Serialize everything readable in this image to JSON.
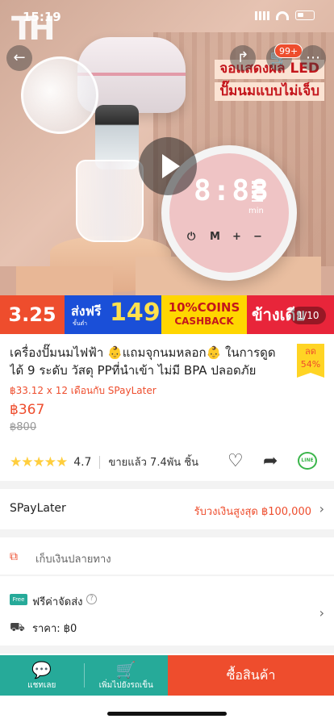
{
  "status_bar": {
    "time": "15:19"
  },
  "hero": {
    "promo_line1": "จอแสดงผล LED",
    "promo_line2": "ปั๊มนมแบบไม่เจ็บ",
    "screen_digits": "8:88",
    "screen_unit": "min",
    "screen_controls": [
      "⏻",
      "M",
      "+",
      "−"
    ],
    "cart_badge": "99+",
    "image_counter": "1/10"
  },
  "banner": {
    "date": "3.25",
    "free_ship_label": "ส่งฟรี",
    "free_ship_min": "ขั้นต่ำ",
    "free_ship_amount": "149",
    "coins_line1": "10%COINS",
    "coins_line2": "CASHBACK",
    "extra": "ข้างเดีย"
  },
  "product": {
    "title": "เครื่องปั๊มนมไฟฟ้า 👶แถมจุกนมหลอก👶 ในการดูดได้ 9 ระดับ วัสดุ PPที่นำเข้า ไม่มี BPA ปลอดภัย ไร้ก...",
    "discount_label": "ลด",
    "discount_value": "54%",
    "installment": "฿33.12 x 12 เดือนกับ SPayLater",
    "price": "฿367",
    "old_price": "฿800",
    "rating": "4.7",
    "sold": "ขายแล้ว 7.4พัน ชิ้น"
  },
  "spaylater": {
    "label": "SPayLater",
    "limit": "รับวงเงินสูงสุด ฿100,000"
  },
  "cod": {
    "label": "เก็บเงินปลายทาง"
  },
  "shipping": {
    "free_label": "ฟรีค่าจัดส่ง",
    "free_icon_text": "Free",
    "cost": "ราคา: ฿0"
  },
  "bottom_bar": {
    "chat_label": "แชทเลย",
    "add_cart_label": "เพิ่มไปยังรถเข็น",
    "buy_label": "ซื้อสินค้า"
  },
  "colors": {
    "accent": "#ee4d2d",
    "teal": "#26aa99",
    "star": "#ffce3d"
  },
  "icons": {
    "back": "back-arrow-icon",
    "share": "share-icon",
    "cart": "cart-icon",
    "more": "more-icon",
    "play": "play-icon",
    "heart": "heart-icon",
    "line": "line-share-icon",
    "chat": "chat-icon",
    "add_cart": "add-cart-icon",
    "truck": "truck-icon",
    "cod": "cod-icon"
  }
}
